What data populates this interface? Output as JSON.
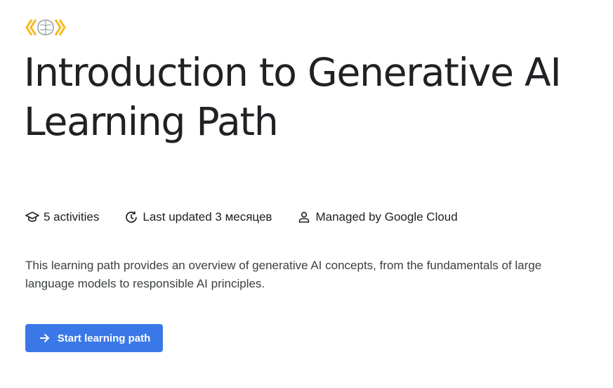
{
  "logo": {
    "icon": "ai-brain-badge-icon",
    "accent": "#f6b91b"
  },
  "title": "Introduction to Generative AI Learning Path",
  "meta": {
    "activities": {
      "icon": "graduation-cap-icon",
      "label": "5 activities"
    },
    "updated": {
      "icon": "clock-update-icon",
      "label": "Last updated 3 месяцев"
    },
    "managed": {
      "icon": "person-icon",
      "label": "Managed by Google Cloud"
    }
  },
  "description": "This learning path provides an overview of generative AI concepts, from the fundamentals of large language models to responsible AI principles.",
  "start_button": {
    "icon": "arrow-right-icon",
    "label": "Start learning path",
    "color": "#3b78e7"
  }
}
